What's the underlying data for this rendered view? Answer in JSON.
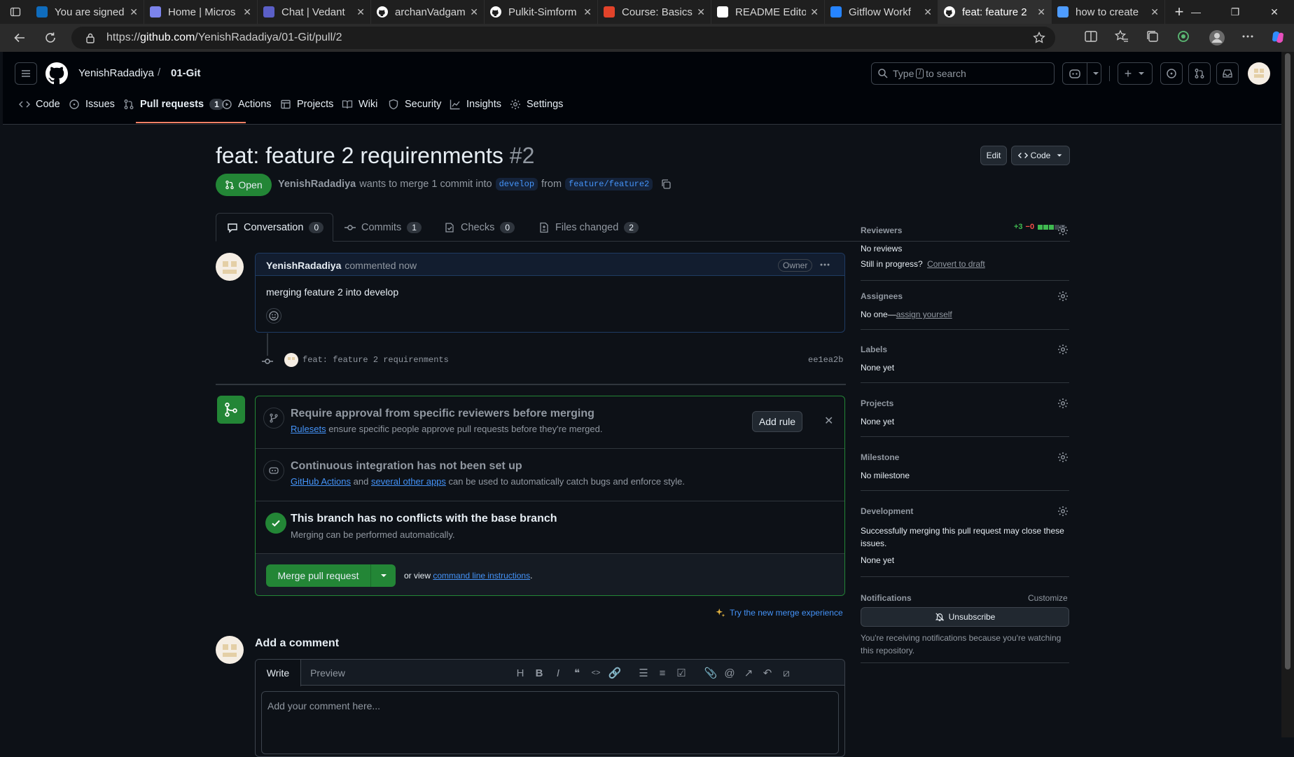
{
  "browser": {
    "tabs": [
      {
        "title": "You are signed",
        "icon": "sharepoint-icon",
        "color": "#0f6cbd"
      },
      {
        "title": "Home | Micros",
        "icon": "m365-icon",
        "color": "#7b83eb"
      },
      {
        "title": "Chat | Vedant",
        "icon": "teams-icon",
        "color": "#5b5fc7"
      },
      {
        "title": "archanVadgam",
        "icon": "github-icon",
        "color": "#ffffff"
      },
      {
        "title": "Pulkit-Simform",
        "icon": "github-icon",
        "color": "#ffffff"
      },
      {
        "title": "Course: Basics",
        "icon": "moodle-icon",
        "color": "#e2432a"
      },
      {
        "title": "README Edito",
        "icon": "readme-icon",
        "color": "#ffffff"
      },
      {
        "title": "Gitflow Workf",
        "icon": "atlassian-icon",
        "color": "#2684ff"
      },
      {
        "title": "feat: feature 2",
        "icon": "github-icon",
        "color": "#ffffff"
      },
      {
        "title": "how to create",
        "icon": "search-icon",
        "color": "#4e9cff"
      }
    ],
    "url_prefix": "https://",
    "url_host": "github.com",
    "url_path": "/YenishRadadiya/01-Git/pull/2"
  },
  "repo": {
    "owner": "YenishRadadiya",
    "separator": "/",
    "name": "01-Git"
  },
  "search": {
    "before": "Type",
    "key": "/",
    "after": "to search"
  },
  "repo_tabs": [
    {
      "label": "Code",
      "icon": "code-icon"
    },
    {
      "label": "Issues",
      "icon": "issue-icon"
    },
    {
      "label": "Pull requests",
      "icon": "pull-request-icon",
      "count": "1"
    },
    {
      "label": "Actions",
      "icon": "play-icon"
    },
    {
      "label": "Projects",
      "icon": "table-icon"
    },
    {
      "label": "Wiki",
      "icon": "book-icon"
    },
    {
      "label": "Security",
      "icon": "shield-icon"
    },
    {
      "label": "Insights",
      "icon": "graph-icon"
    },
    {
      "label": "Settings",
      "icon": "gear-icon"
    }
  ],
  "pr": {
    "title": "feat: feature 2 requirenments",
    "number": "#2",
    "state": "Open",
    "author": "YenishRadadiya",
    "merge_text": "wants to merge 1 commit into",
    "base": "develop",
    "from_text": "from",
    "head": "feature/feature2",
    "edit_label": "Edit",
    "code_label": "Code"
  },
  "pr_tabs": [
    {
      "label": "Conversation",
      "count": "0",
      "icon": "comment-icon"
    },
    {
      "label": "Commits",
      "count": "1",
      "icon": "commit-icon"
    },
    {
      "label": "Checks",
      "count": "0",
      "icon": "checklist-icon"
    },
    {
      "label": "Files changed",
      "count": "2",
      "icon": "file-diff-icon"
    }
  ],
  "diffstat": {
    "add": "+3",
    "del": "−0"
  },
  "comment": {
    "author": "YenishRadadiya",
    "time": "commented now",
    "role": "Owner",
    "body": "merging feature 2 into develop"
  },
  "commit": {
    "message": "feat: feature 2 requirenments",
    "sha": "ee1ea2b"
  },
  "merge_box": {
    "rule_title": "Require approval from specific reviewers before merging",
    "rule_link": "Rulesets",
    "rule_text": "ensure specific people approve pull requests before they're merged.",
    "add_rule": "Add rule",
    "ci_title": "Continuous integration has not been set up",
    "ci_link1": "GitHub Actions",
    "ci_and": "and",
    "ci_link2": "several other apps",
    "ci_text": "can be used to automatically catch bugs and enforce style.",
    "conflict_title": "This branch has no conflicts with the base branch",
    "conflict_text": "Merging can be performed automatically.",
    "merge_button": "Merge pull request",
    "or_view": "or view",
    "cli_link": "command line instructions",
    "period": ".",
    "new_experience": "Try the new merge experience"
  },
  "add_comment": {
    "heading": "Add a comment",
    "write": "Write",
    "preview": "Preview",
    "placeholder": "Add your comment here..."
  },
  "sidebar": {
    "reviewers_h": "Reviewers",
    "reviewers_v": "No reviews",
    "progress_q": "Still in progress?",
    "progress_link": "Convert to draft",
    "assignees_h": "Assignees",
    "assignees_v": "No one—",
    "assignees_link": "assign yourself",
    "labels_h": "Labels",
    "labels_v": "None yet",
    "projects_h": "Projects",
    "projects_v": "None yet",
    "milestone_h": "Milestone",
    "milestone_v": "No milestone",
    "development_h": "Development",
    "development_t": "Successfully merging this pull request may close these issues.",
    "development_v": "None yet",
    "notifications_h": "Notifications",
    "customize": "Customize",
    "unsubscribe": "Unsubscribe",
    "notif_text": "You're receiving notifications because you're watching this repository."
  }
}
